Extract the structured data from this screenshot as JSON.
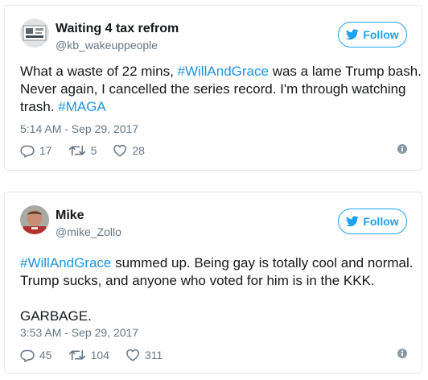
{
  "colors": {
    "accent": "#1da1f2",
    "hashtag": "#1b95e0",
    "muted": "#657786",
    "text": "#14171a",
    "border": "#e1e8ed"
  },
  "tweets": [
    {
      "name": "Waiting 4 tax refrom",
      "handle": "@kb_wakeuppeople",
      "follow_label": "Follow",
      "text": {
        "l1a": "What a waste of 22 mins, ",
        "l1b": "#WillAndGrace",
        "l1c": " was a lame Trump bash.",
        "l2": "Never again, I cancelled the series record. I'm through watching",
        "l3a": "trash. ",
        "l3b": "#MAGA"
      },
      "time": "5:14 AM - Sep 29, 2017",
      "replies": "17",
      "retweets": "5",
      "likes": "28"
    },
    {
      "name": "Mike",
      "handle": "@mike_Zollo",
      "follow_label": "Follow",
      "text": {
        "l1a": "#WillAndGrace",
        "l1b": " summed up. Being gay is totally cool and normal.",
        "l2": "Trump sucks, and anyone who voted for him is in the KKK.",
        "l3": "GARBAGE."
      },
      "time": "3:53 AM - Sep 29, 2017",
      "replies": "45",
      "retweets": "104",
      "likes": "311"
    }
  ]
}
